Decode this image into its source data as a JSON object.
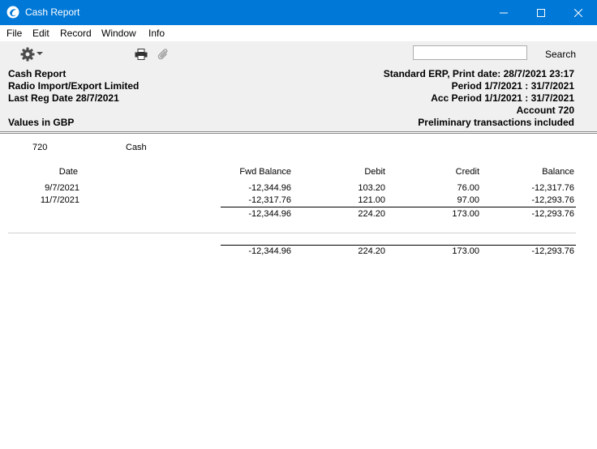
{
  "window": {
    "title": "Cash Report",
    "minimize": "—",
    "maximize": "☐",
    "close": "✕"
  },
  "menu": [
    "File",
    "Edit",
    "Record",
    "Window",
    "Info"
  ],
  "toolbar": {
    "search_value": "",
    "search_label": "Search"
  },
  "header": {
    "left": [
      "Cash Report",
      "Radio Import/Export Limited",
      "Last Reg Date  28/7/2021",
      "Values in GBP"
    ],
    "right": [
      "Standard ERP, Print date: 28/7/2021 23:17",
      "Period  1/7/2021 : 31/7/2021",
      "Acc Period  1/1/2021 : 31/7/2021",
      "Account  720",
      "Preliminary transactions included"
    ]
  },
  "account": {
    "number": "720",
    "name": "Cash"
  },
  "columns": {
    "date": "Date",
    "fwd_balance": "Fwd Balance",
    "debit": "Debit",
    "credit": "Credit",
    "balance": "Balance"
  },
  "rows": [
    {
      "date": "9/7/2021",
      "fwd_balance": "-12,344.96",
      "debit": "103.20",
      "credit": "76.00",
      "balance": "-12,317.76"
    },
    {
      "date": "11/7/2021",
      "fwd_balance": "-12,317.76",
      "debit": "121.00",
      "credit": "97.00",
      "balance": "-12,293.76"
    }
  ],
  "subtotal": {
    "fwd_balance": "-12,344.96",
    "debit": "224.20",
    "credit": "173.00",
    "balance": "-12,293.76"
  },
  "total": {
    "fwd_balance": "-12,344.96",
    "debit": "224.20",
    "credit": "173.00",
    "balance": "-12,293.76"
  }
}
